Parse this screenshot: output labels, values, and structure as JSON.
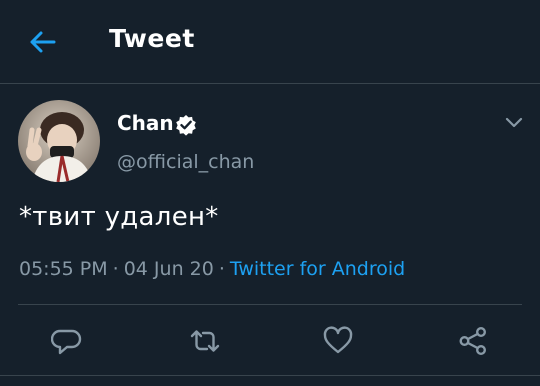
{
  "header": {
    "title": "Tweet",
    "back_icon": "arrow-left-icon"
  },
  "tweet": {
    "display_name": "Chan",
    "verified_icon": "verified-badge-icon",
    "handle": "@official_chan",
    "text": "*твит удален*",
    "time": "05:55 PM",
    "date": "04 Jun 20",
    "source": "Twitter for Android",
    "separator": "·",
    "menu_icon": "chevron-down-icon"
  },
  "actions": [
    {
      "name": "reply",
      "icon": "reply-icon"
    },
    {
      "name": "retweet",
      "icon": "retweet-icon"
    },
    {
      "name": "like",
      "icon": "like-icon"
    },
    {
      "name": "share",
      "icon": "share-icon"
    }
  ],
  "colors": {
    "background": "#15202b",
    "accent": "#1da1f2",
    "secondary_text": "#8899a6",
    "divider": "#38444d",
    "primary_text": "#ffffff"
  }
}
